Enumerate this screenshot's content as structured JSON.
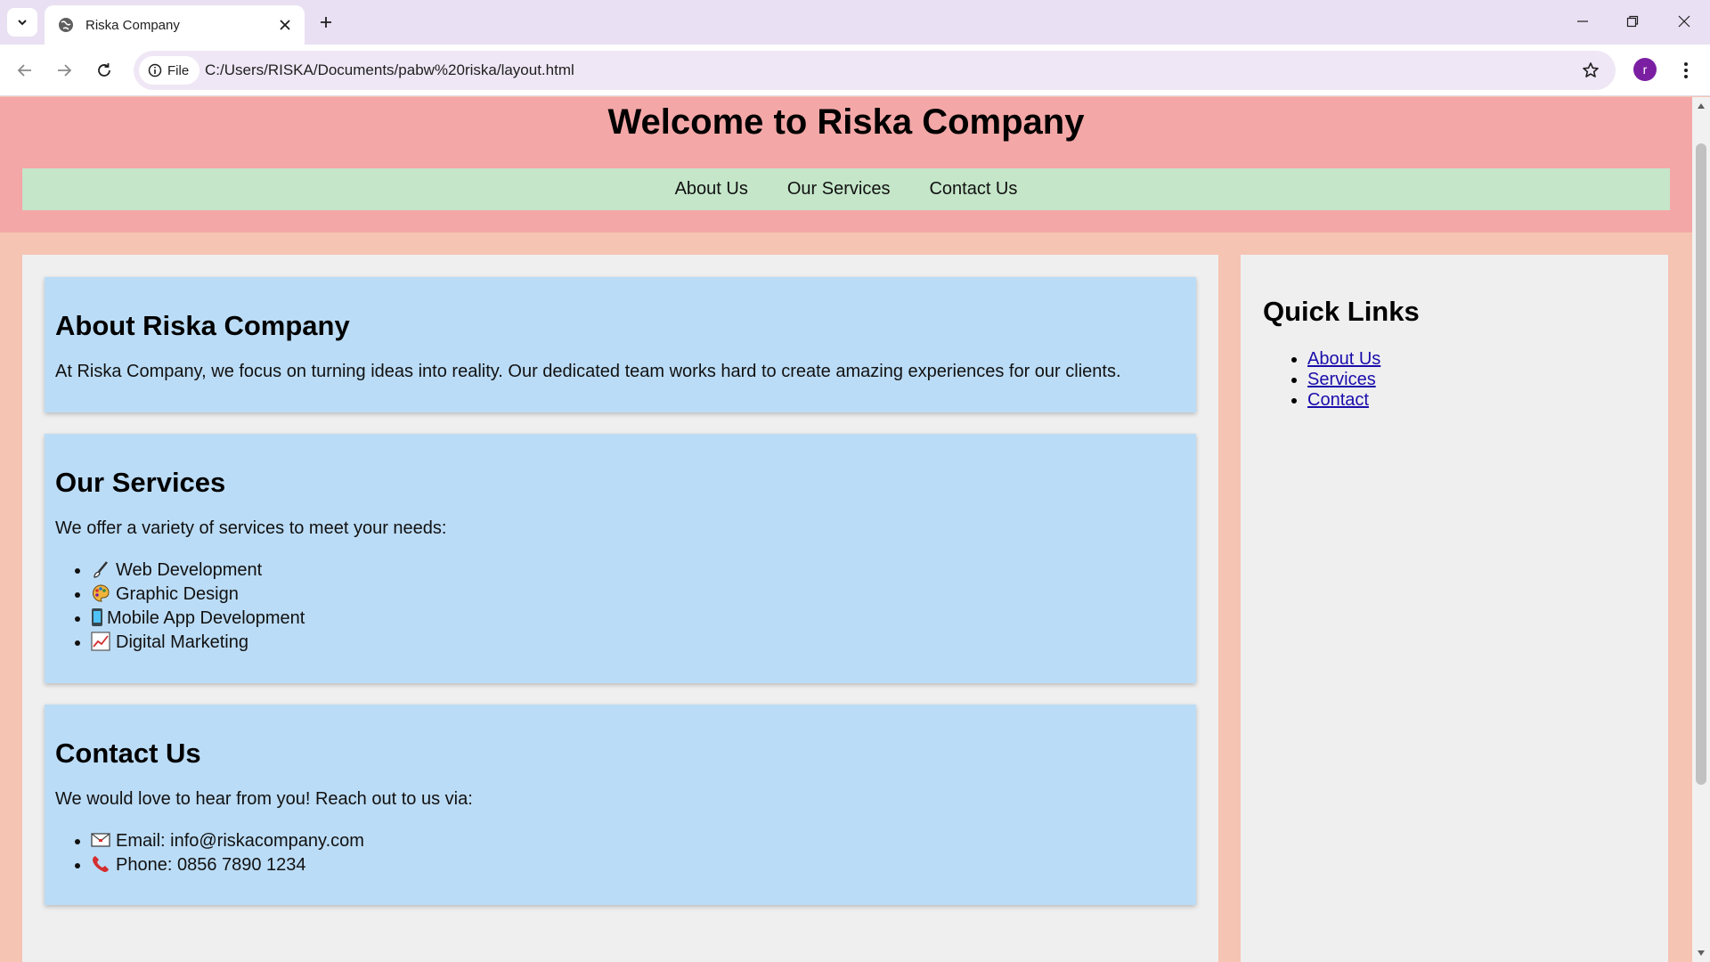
{
  "browser": {
    "tab_title": "Riska Company",
    "chip_label": "File",
    "url": "C:/Users/RISKA/Documents/pabw%20riska/layout.html",
    "profile_initial": "r"
  },
  "page": {
    "title": "Welcome to Riska Company",
    "nav": [
      "About Us",
      "Our Services",
      "Contact Us"
    ],
    "about": {
      "heading": "About Riska Company",
      "text": "At Riska Company, we focus on turning ideas into reality. Our dedicated team works hard to create amazing experiences for our clients."
    },
    "services": {
      "heading": "Our Services",
      "intro": "We offer a variety of services to meet your needs:",
      "items": [
        "Web Development",
        "Graphic Design",
        "Mobile App Development",
        "Digital Marketing"
      ]
    },
    "contact": {
      "heading": "Contact Us",
      "intro": "We would love to hear from you! Reach out to us via:",
      "items": [
        "Email: info@riskacompany.com",
        "Phone: 0856 7890 1234"
      ]
    },
    "sidebar": {
      "heading": "Quick Links",
      "links": [
        "About Us",
        "Services",
        "Contact"
      ]
    }
  },
  "colors": {
    "header_bg": "#f4a7a7",
    "nav_bg": "#c5e6c9",
    "page_bg": "#f5c4b3",
    "card_bg": "#bbdcf6"
  }
}
